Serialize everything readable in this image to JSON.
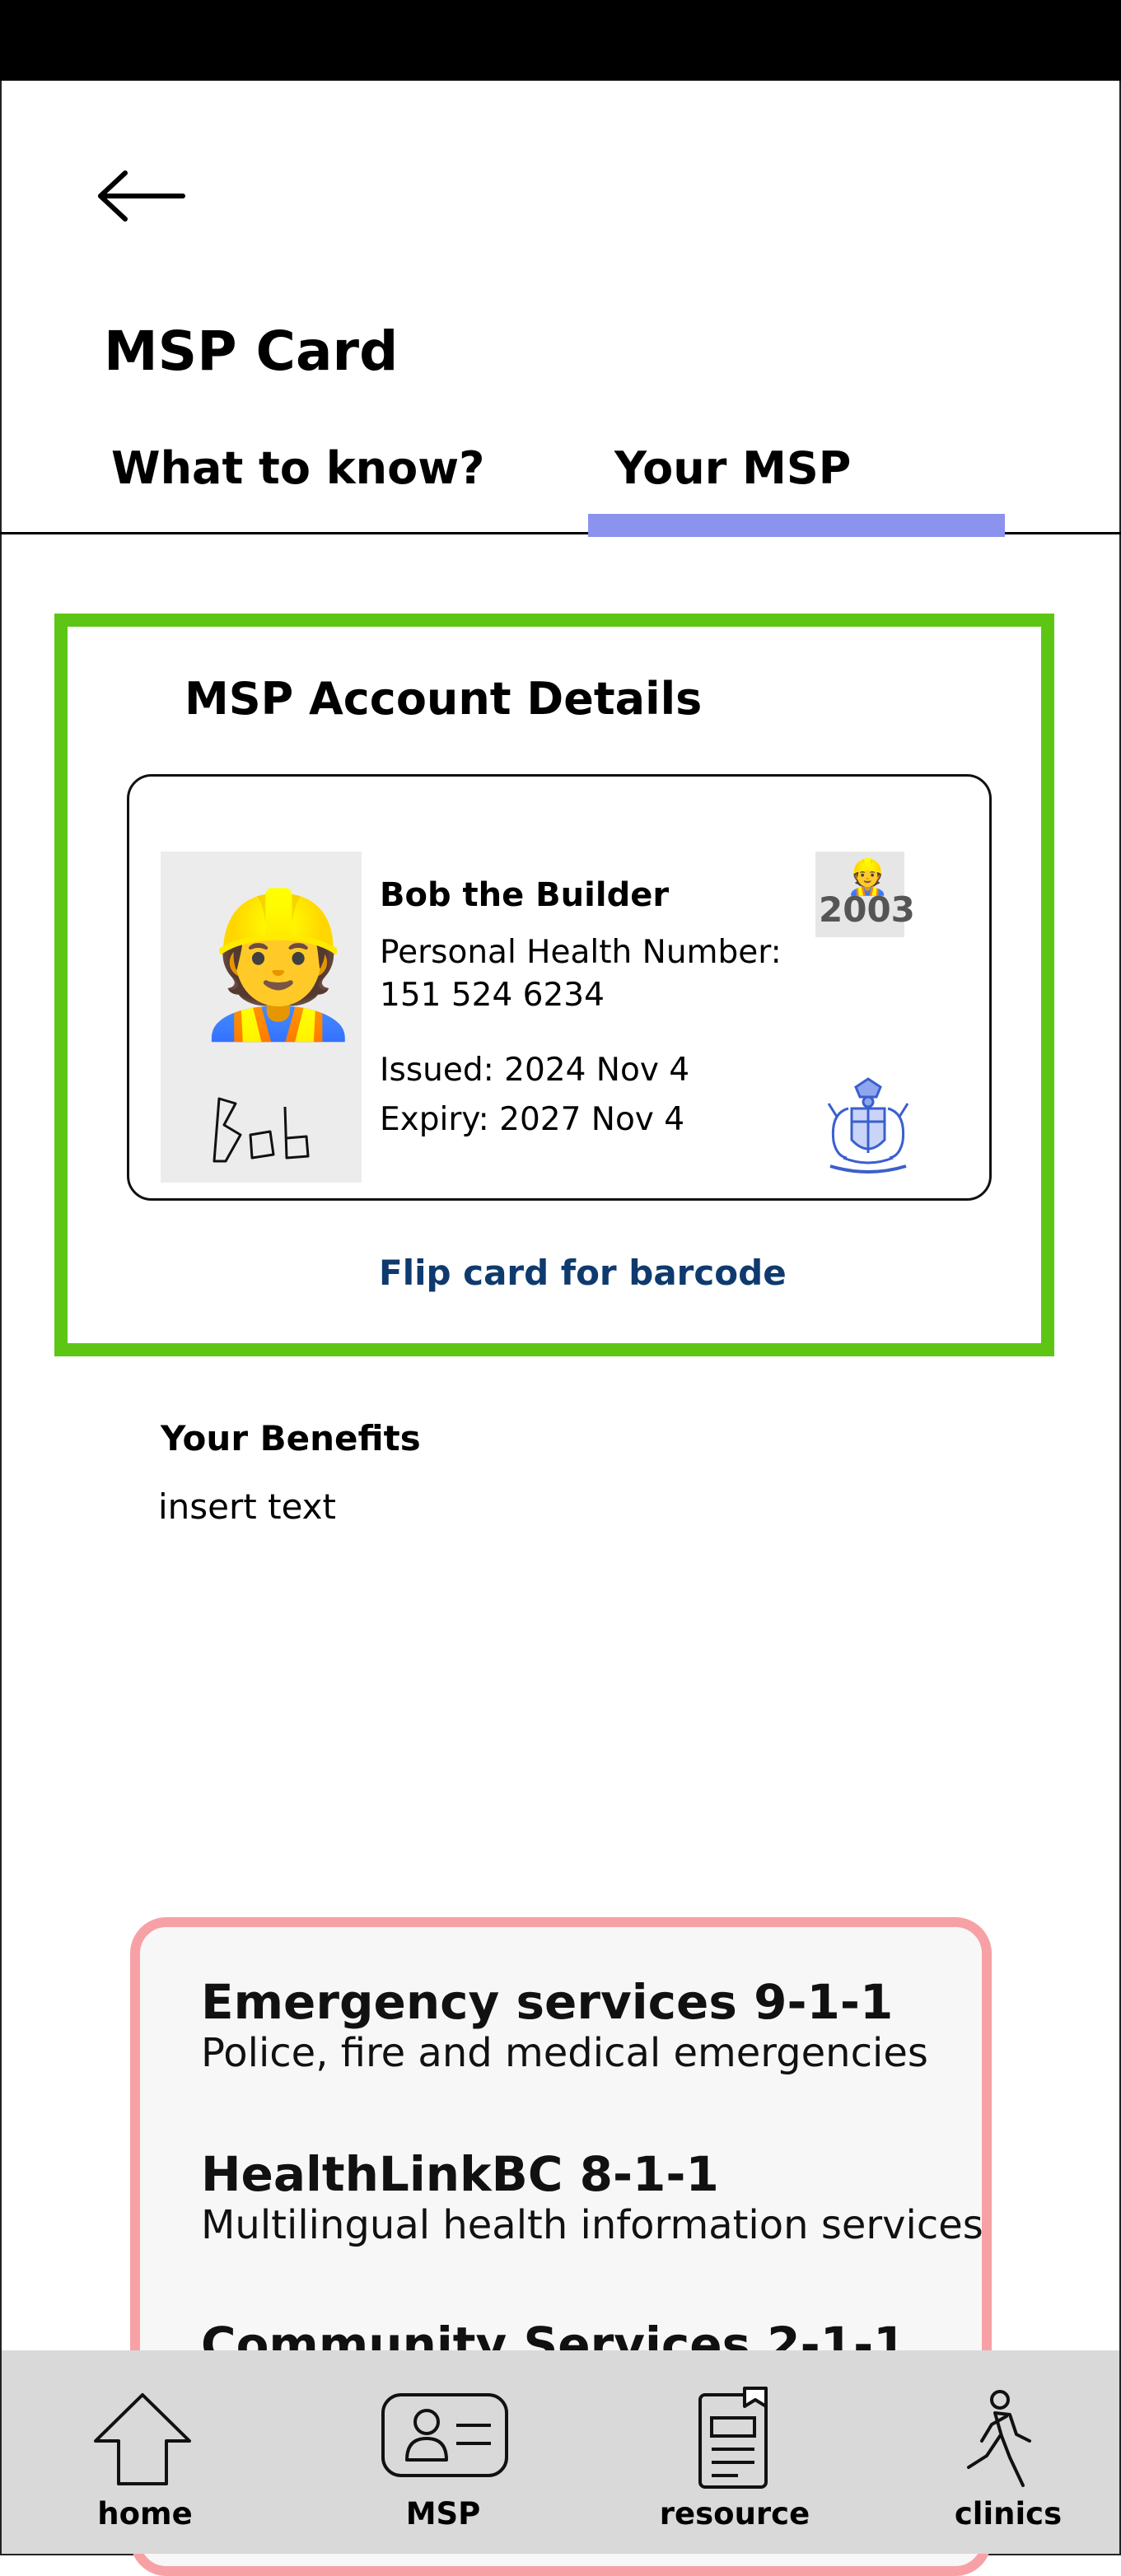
{
  "header": {
    "back_icon": "arrow-left-icon",
    "title": "MSP Card"
  },
  "tabs": [
    {
      "label": "What to know?",
      "active": false
    },
    {
      "label": "Your MSP",
      "active": true
    }
  ],
  "colors": {
    "tab_indicator": "#8b93ee",
    "details_border": "#5dc614",
    "emergency_border": "#f7a1a6",
    "link": "#0e3a6e",
    "nav_bg": "#d9d9d9"
  },
  "account": {
    "section_title": "MSP Account Details",
    "card": {
      "photo_icon": "construction-worker-emoji",
      "avatar_emoji": "👷",
      "signature_text": "Bob",
      "name": "Bob the Builder",
      "phn_label": "Personal Health Number:",
      "phn": "151 524 6234",
      "issued": "Issued: 2024 Nov 4",
      "expiry": "Expiry: 2027 Nov 4",
      "year_badge_emoji": "👷",
      "year_badge": "2003",
      "crest_icon": "bc-coat-of-arms-icon"
    },
    "flip_link": "Flip card for barcode"
  },
  "benefits": {
    "title": "Your Benefits",
    "text": "insert text"
  },
  "emergency": [
    {
      "title": "Emergency services 9-1-1",
      "subtitle": "Police, fire and medical emergencies"
    },
    {
      "title": "HealthLinkBC 8-1-1",
      "subtitle": "Multilingual health information services"
    },
    {
      "title": "Community Services 2-1-1",
      "subtitle": ""
    }
  ],
  "bottom_nav": [
    {
      "label": "home",
      "icon": "home-icon"
    },
    {
      "label": "MSP",
      "icon": "id-card-icon"
    },
    {
      "label": "resource",
      "icon": "document-icon"
    },
    {
      "label": "clinics",
      "icon": "walking-person-icon"
    }
  ]
}
